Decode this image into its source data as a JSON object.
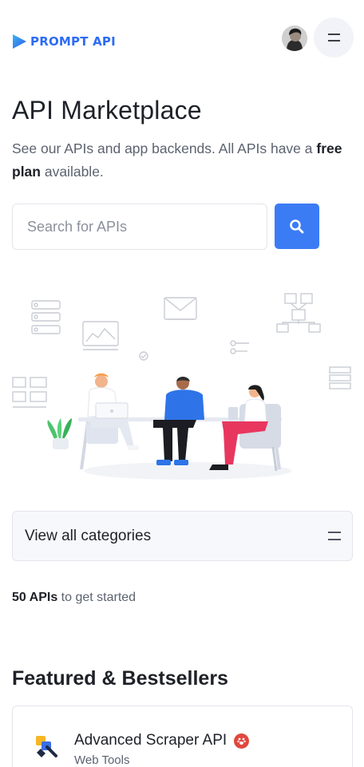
{
  "header": {
    "logo_text": "PROMPT API",
    "logo_icon": "play-triangle-icon",
    "avatar": "user-avatar",
    "menu_icon": "hamburger-menu-icon"
  },
  "hero": {
    "title": "API Marketplace",
    "subtitle_before": "See our APIs and app backends. All APIs have a ",
    "subtitle_bold": "free plan",
    "subtitle_after": " available."
  },
  "search": {
    "value": "",
    "placeholder": "Search for APIs",
    "button_icon": "search-icon"
  },
  "illustration": {
    "description_icon": "team-meeting-illustration"
  },
  "categories": {
    "label": "View all categories",
    "icon": "hamburger-menu-icon"
  },
  "count": {
    "number": "50 APIs",
    "suffix": " to get started"
  },
  "featured": {
    "title": "Featured & Bestsellers",
    "cards": [
      {
        "name": "Advanced Scraper API",
        "category": "Web Tools",
        "badge_icon": "paw-badge-icon",
        "icon": "scraper-brush-icon"
      }
    ]
  },
  "colors": {
    "brand": "#2d6cf5",
    "search_button": "#3b7cf5",
    "badge": "#e0483e"
  }
}
